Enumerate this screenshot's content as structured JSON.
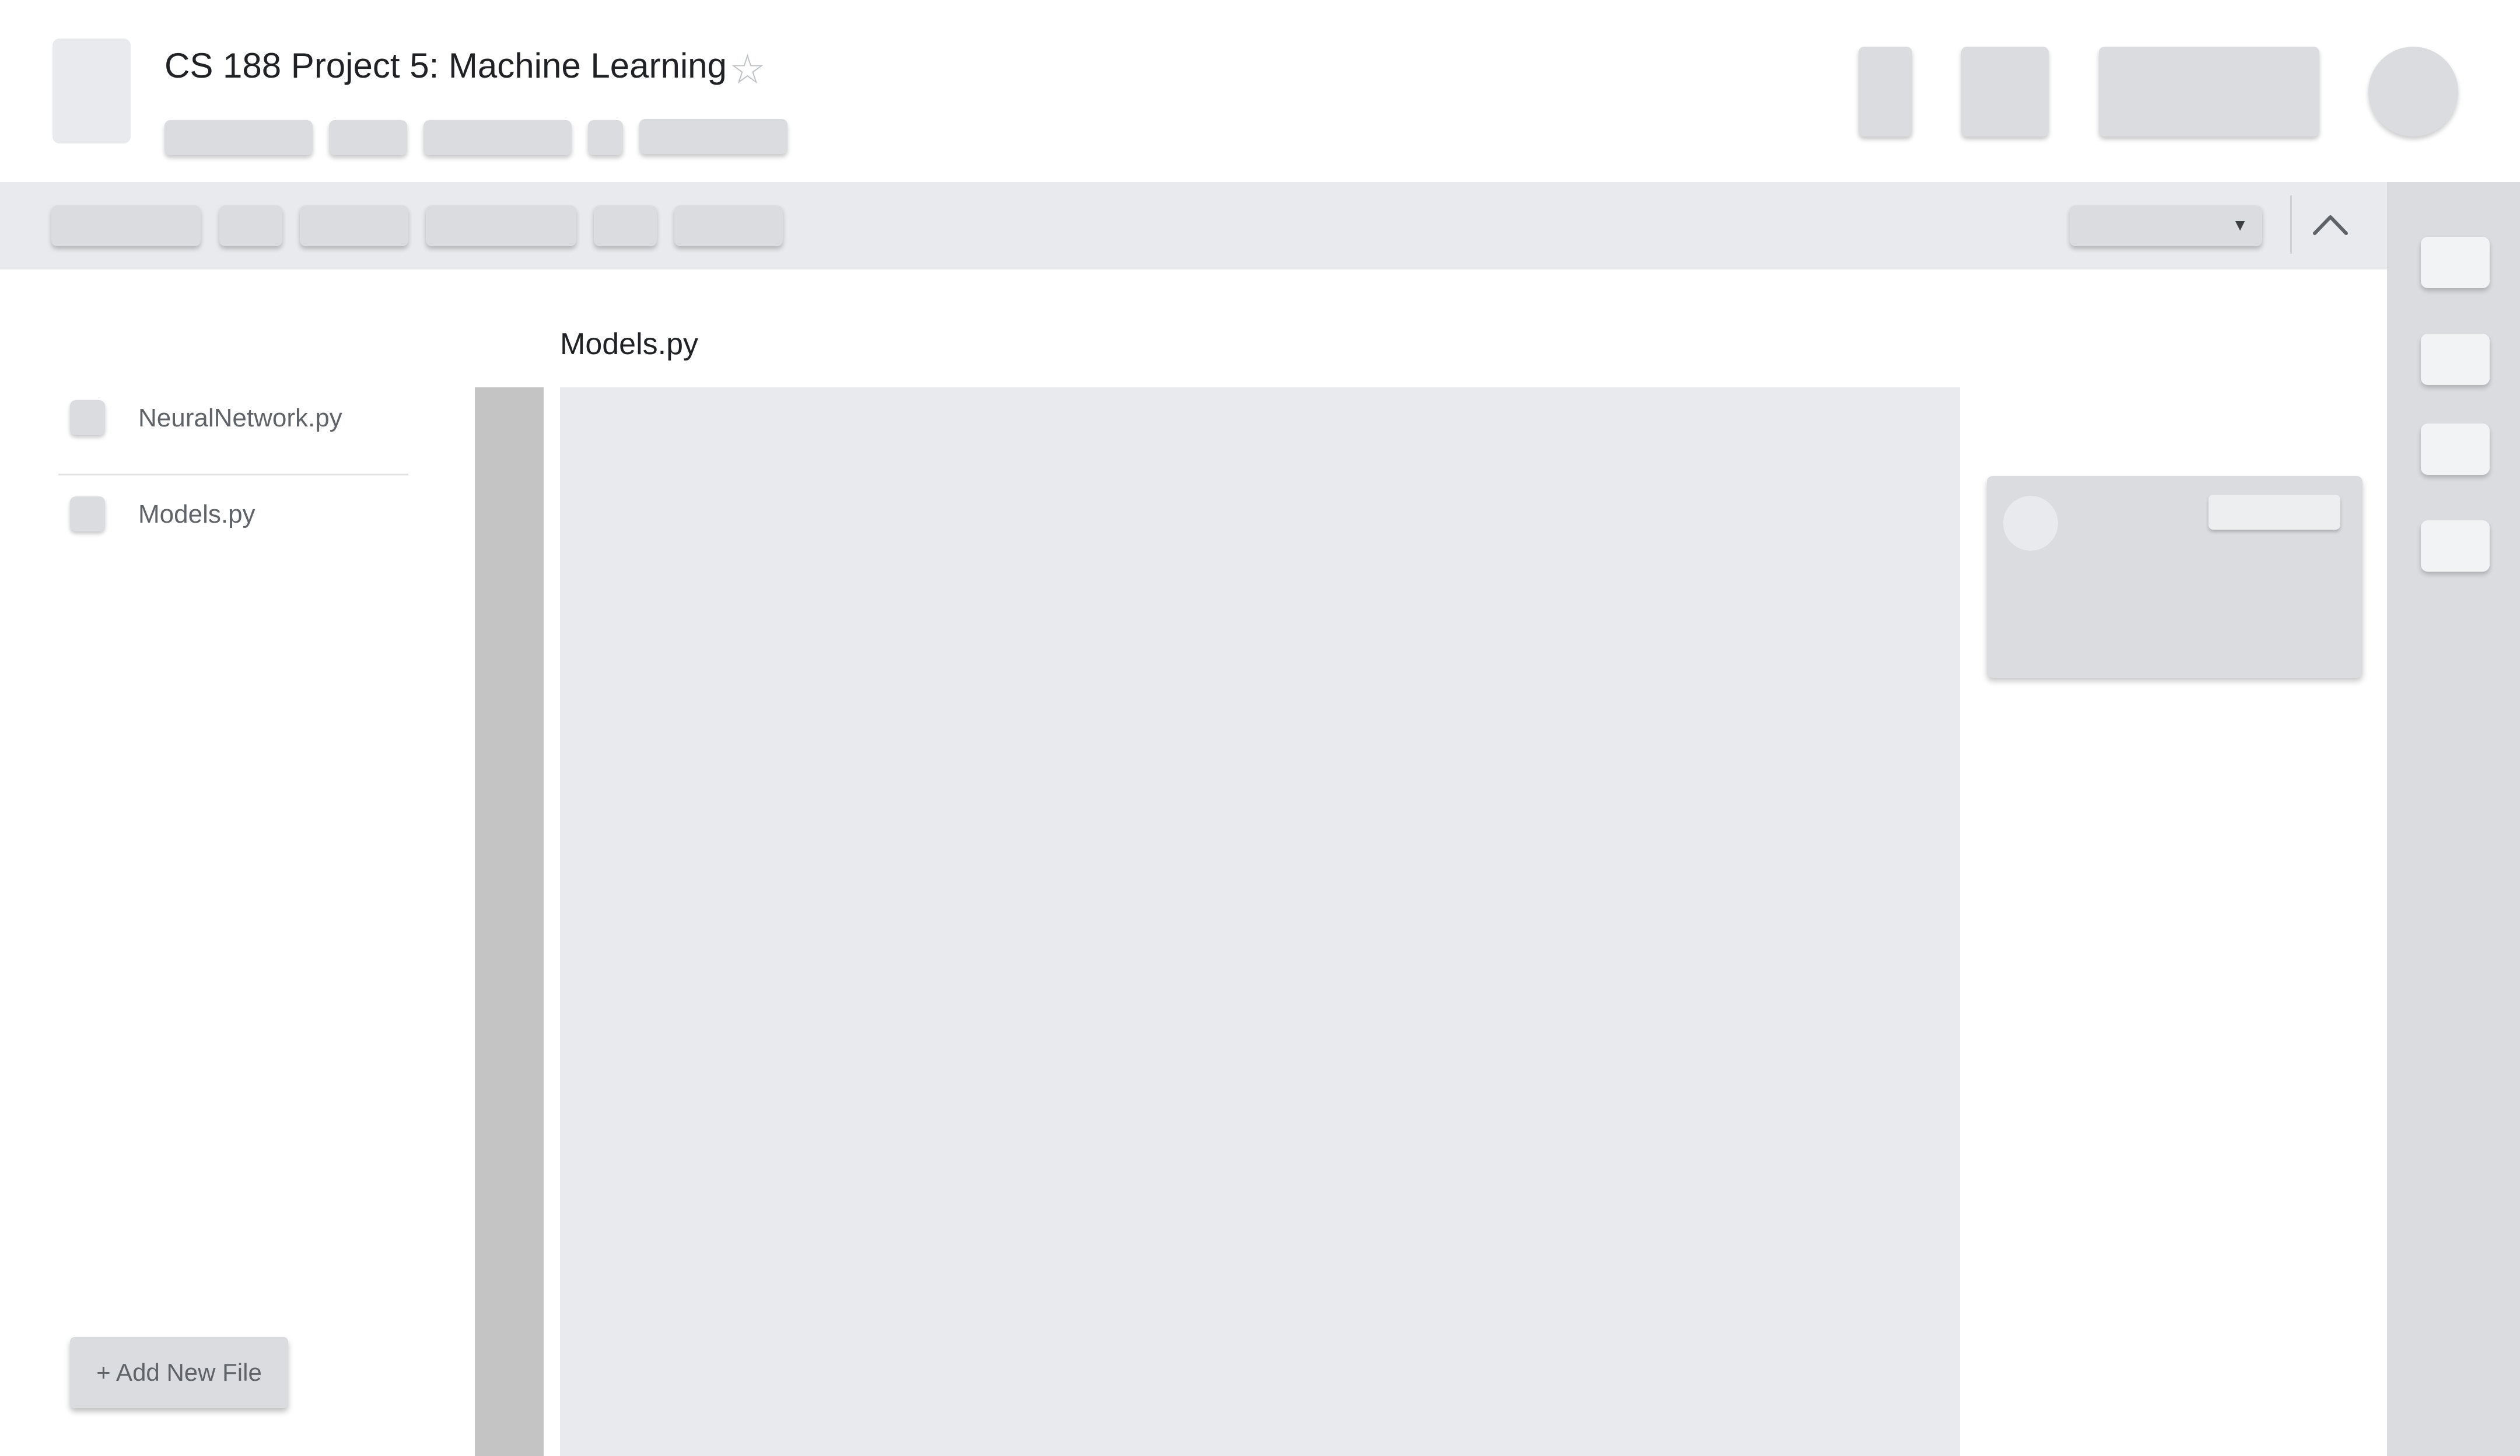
{
  "header": {
    "title": "CS 188 Project 5: Machine Learning",
    "star_icon": "star-outline-icon"
  },
  "toolbar": {
    "collapse_icon": "chevron-up-icon",
    "dropdown_icon": "caret-down-icon"
  },
  "files": {
    "items": [
      {
        "name": "NeuralNetwork.py"
      },
      {
        "name": "Models.py"
      }
    ],
    "add_label": "+ Add New File"
  },
  "editor": {
    "filename": "Models.py"
  }
}
